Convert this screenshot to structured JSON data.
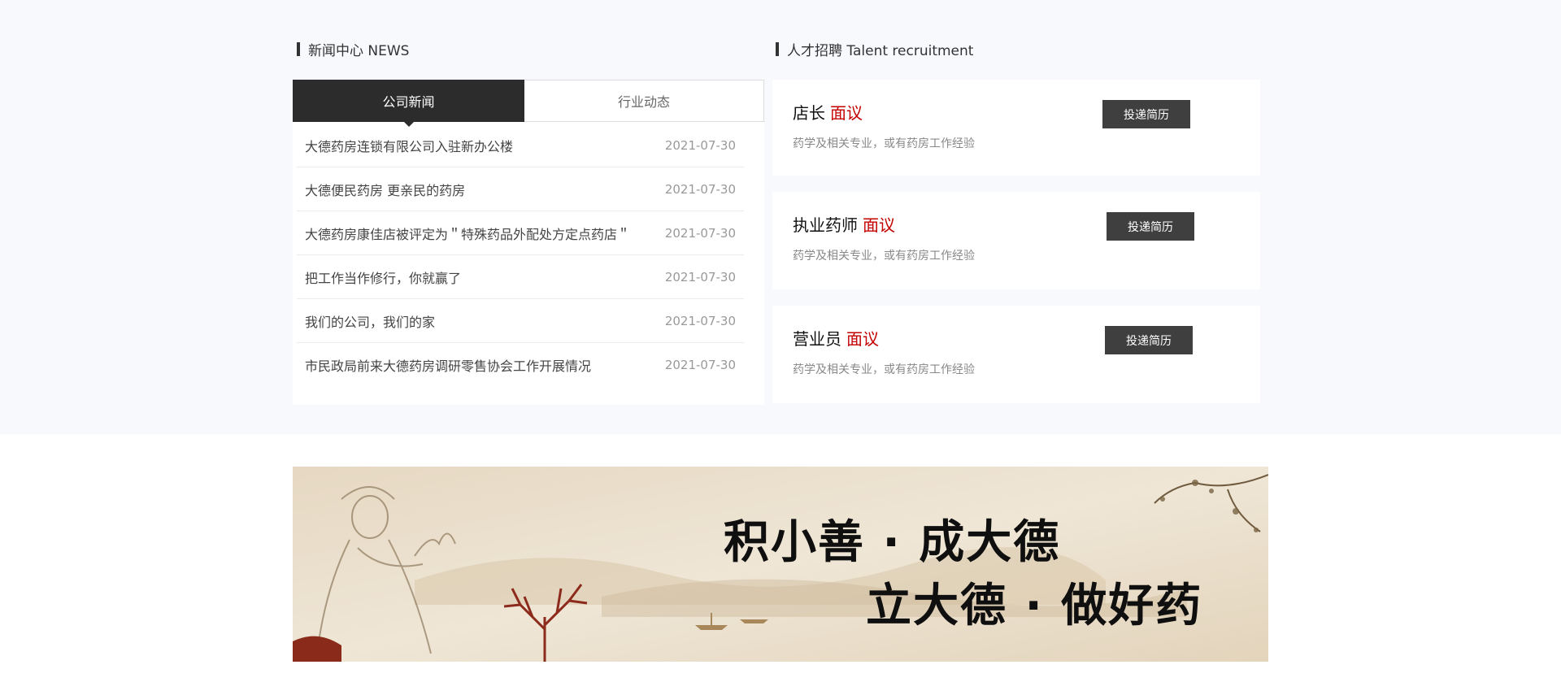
{
  "news_section": {
    "title": "新闻中心 NEWS",
    "tabs": [
      {
        "label": "公司新闻",
        "active": true
      },
      {
        "label": "行业动态",
        "active": false
      }
    ],
    "items": [
      {
        "title": "大德药房连锁有限公司入驻新办公楼",
        "date": "2021-07-30"
      },
      {
        "title": "大德便民药房 更亲民的药房",
        "date": "2021-07-30"
      },
      {
        "title": "大德药房康佳店被评定为＂特殊药品外配处方定点药店＂",
        "date": "2021-07-30"
      },
      {
        "title": "把工作当作修行，你就赢了",
        "date": "2021-07-30"
      },
      {
        "title": "我们的公司，我们的家",
        "date": "2021-07-30"
      },
      {
        "title": "市民政局前来大德药房调研零售协会工作开展情况",
        "date": "2021-07-30"
      }
    ]
  },
  "jobs_section": {
    "title": "人才招聘 Talent recruitment",
    "jobs": [
      {
        "name": "店长",
        "salary": "面议",
        "desc": "药学及相关专业，或有药房工作经验",
        "apply_label": "投递简历"
      },
      {
        "name": "执业药师",
        "salary": "面议",
        "desc": "药学及相关专业，或有药房工作经验",
        "apply_label": "投递简历"
      },
      {
        "name": "营业员",
        "salary": "面议",
        "desc": "药学及相关专业，或有药房工作经验",
        "apply_label": "投递简历"
      }
    ]
  },
  "banner": {
    "line1": "积小善 · 成大德",
    "line2": "立大德 · 做好药"
  },
  "colors": {
    "band_bg": "#f8f9fd",
    "tab_active": "#2c2c2c",
    "salary": "#c40000",
    "apply_button": "#3f3f3f"
  }
}
